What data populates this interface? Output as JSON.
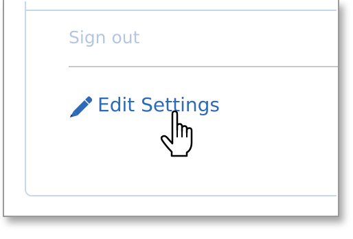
{
  "menu": {
    "signout_label": "Sign out",
    "edit_settings_label": "Edit Settings"
  },
  "icons": {
    "edit": "pencil-icon",
    "cursor": "hand-pointer-cursor-icon"
  },
  "colors": {
    "signout_text": "#b6c6e0",
    "link_text": "#2f6ab8",
    "pencil": "#2f6ab8",
    "panel_border": "#c6d7ee",
    "divider": "#c8c8c8"
  }
}
